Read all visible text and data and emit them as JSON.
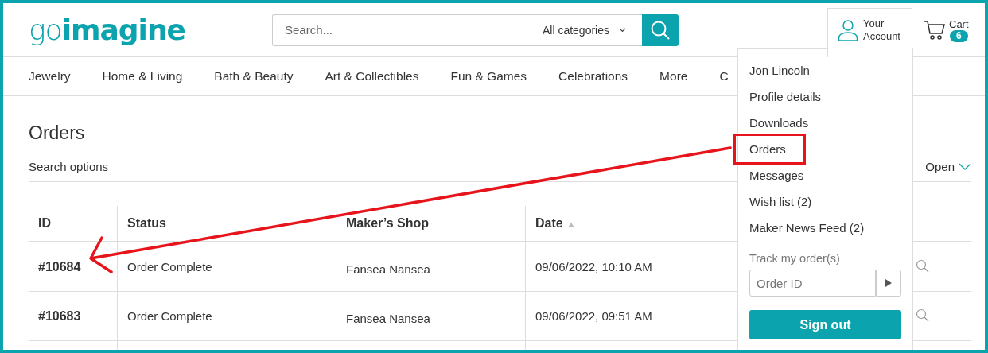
{
  "header": {
    "logo": {
      "light": "go",
      "bold": "imagine"
    },
    "search": {
      "placeholder": "Search...",
      "category": "All categories"
    },
    "account": {
      "line_1": "Your",
      "line_2": "Account"
    },
    "cart": {
      "label": "Cart",
      "count": "6"
    }
  },
  "nav": [
    "Jewelry",
    "Home & Living",
    "Bath & Beauty",
    "Art & Collectibles",
    "Fun & Games",
    "Celebrations",
    "More",
    "C"
  ],
  "page": {
    "title": "Orders",
    "search_options": "Search options",
    "toggle": "Open"
  },
  "table": {
    "columns": [
      {
        "label": "ID",
        "sorted": false
      },
      {
        "label": "Status",
        "sorted": false
      },
      {
        "label": "Maker’s Shop",
        "sorted": false
      },
      {
        "label": "Date",
        "sorted": true
      }
    ],
    "rows": [
      {
        "id": "#10684",
        "status": "Order Complete",
        "shop": "Fansea Nansea",
        "date": "09/06/2022, 10:10 AM"
      },
      {
        "id": "#10683",
        "status": "Order Complete",
        "shop": "Fansea Nansea",
        "date": "09/06/2022, 09:51 AM"
      }
    ]
  },
  "account_menu": {
    "items": [
      {
        "label": "Jon Lincoln",
        "highlighted": false
      },
      {
        "label": "Profile details",
        "highlighted": false
      },
      {
        "label": "Downloads",
        "highlighted": false
      },
      {
        "label": "Orders",
        "highlighted": true
      },
      {
        "label": "Messages",
        "highlighted": false
      },
      {
        "label": "Wish list (2)",
        "highlighted": false
      },
      {
        "label": "Maker News Feed (2)",
        "highlighted": false
      }
    ],
    "track_label": "Track my order(s)",
    "track_placeholder": "Order ID",
    "sign_out": "Sign out"
  }
}
